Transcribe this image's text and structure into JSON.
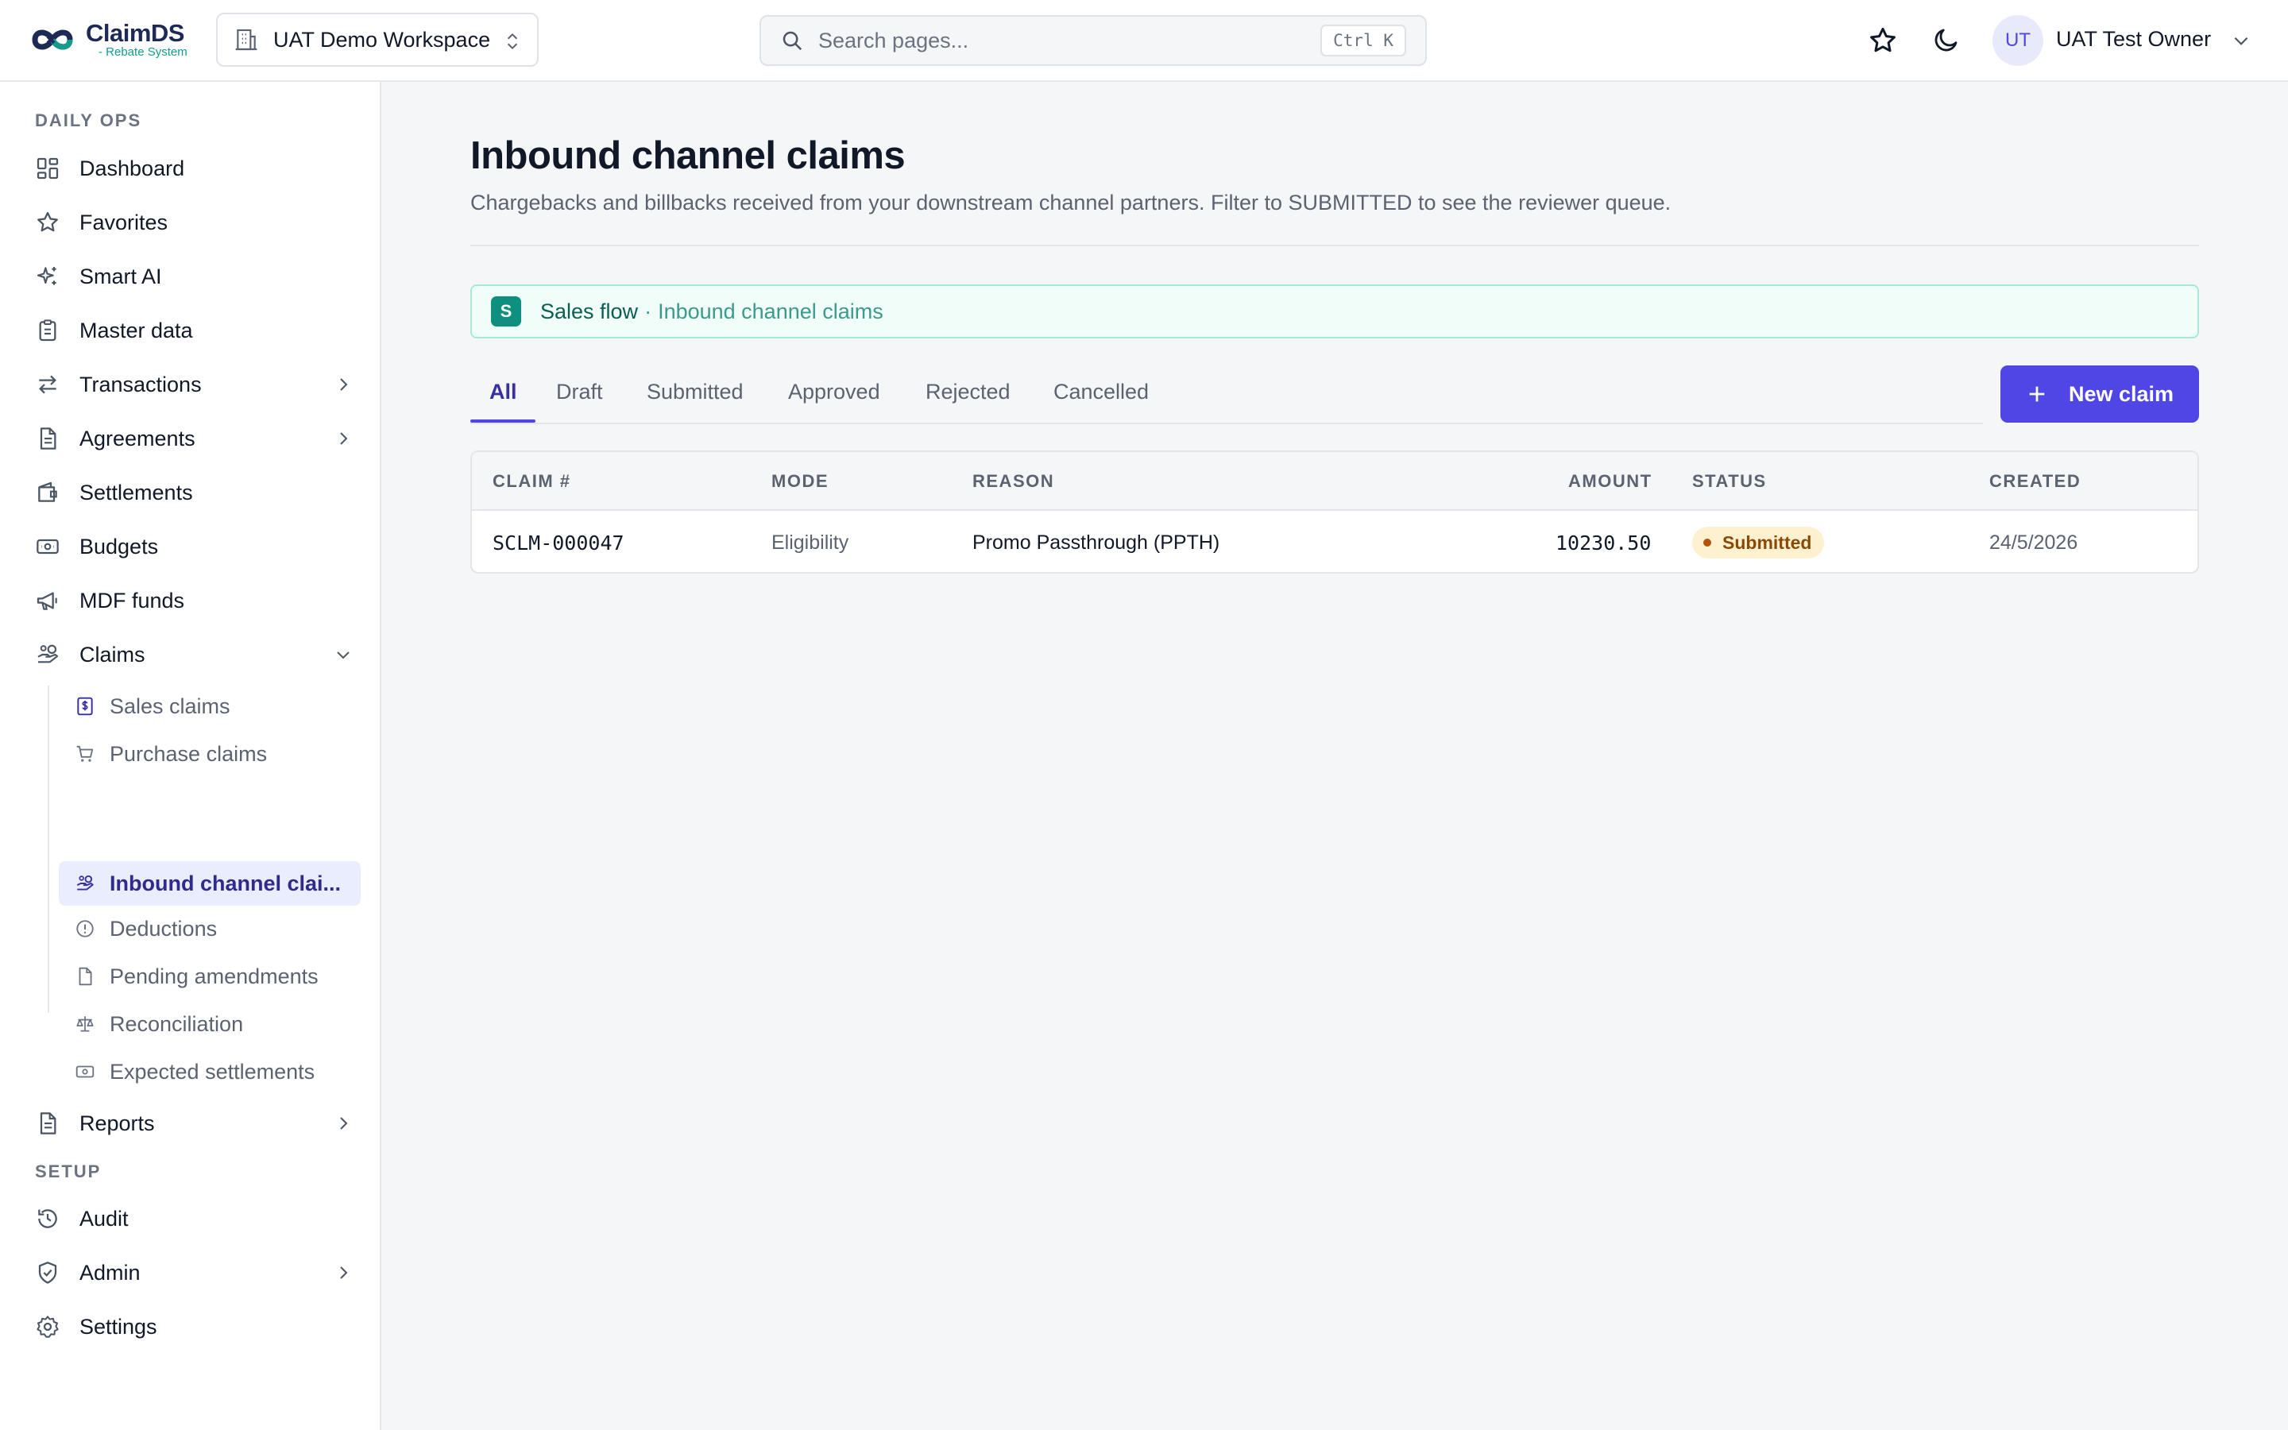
{
  "app": {
    "logo_name": "ClaimDS",
    "logo_tagline": "- Rebate System"
  },
  "header": {
    "workspace": "UAT Demo Workspace",
    "search_placeholder": "Search pages...",
    "search_shortcut": "Ctrl K",
    "user_initials": "UT",
    "user_name": "UAT Test Owner"
  },
  "sidebar": {
    "sections": [
      {
        "label": "DAILY OPS"
      },
      {
        "label": "SETUP"
      }
    ],
    "items": [
      {
        "label": "Dashboard",
        "icon": "dashboard-icon"
      },
      {
        "label": "Favorites",
        "icon": "star-icon"
      },
      {
        "label": "Smart AI",
        "icon": "sparkles-icon"
      },
      {
        "label": "Master data",
        "icon": "clipboard-icon"
      },
      {
        "label": "Transactions",
        "icon": "arrows-exchange-icon"
      },
      {
        "label": "Agreements",
        "icon": "document-icon"
      },
      {
        "label": "Settlements",
        "icon": "wallet-icon"
      },
      {
        "label": "Budgets",
        "icon": "banknote-icon"
      },
      {
        "label": "MDF funds",
        "icon": "megaphone-icon"
      },
      {
        "label": "Claims",
        "icon": "hand-coins-icon"
      },
      {
        "label": "Reports",
        "icon": "report-icon"
      },
      {
        "label": "Audit",
        "icon": "history-icon"
      },
      {
        "label": "Admin",
        "icon": "shield-icon"
      },
      {
        "label": "Settings",
        "icon": "gear-icon"
      }
    ],
    "claims_sub": [
      {
        "label": "Sales claims",
        "icon": "receipt-dollar-icon"
      },
      {
        "label": "Purchase claims",
        "icon": "cart-icon"
      },
      {
        "label": "Inbound channel clai...",
        "icon": "hand-coins-icon"
      },
      {
        "label": "Deductions",
        "icon": "alert-circle-icon"
      },
      {
        "label": "Pending amendments",
        "icon": "file-icon"
      },
      {
        "label": "Reconciliation",
        "icon": "scale-icon"
      },
      {
        "label": "Expected settlements",
        "icon": "banknote-icon"
      }
    ]
  },
  "main": {
    "title": "Inbound channel claims",
    "subtitle": "Chargebacks and billbacks received from your downstream channel partners. Filter to SUBMITTED to see the reviewer queue.",
    "flow": {
      "badge": "S",
      "name": "Sales flow",
      "separator": "·",
      "crumb": "Inbound channel claims"
    },
    "tabs": [
      "All",
      "Draft",
      "Submitted",
      "Approved",
      "Rejected",
      "Cancelled"
    ],
    "new_button": "New claim",
    "table": {
      "columns": [
        "CLAIM #",
        "MODE",
        "REASON",
        "AMOUNT",
        "STATUS",
        "CREATED"
      ],
      "rows": [
        {
          "claim": "SCLM-000047",
          "mode": "Eligibility",
          "reason": "Promo Passthrough (PPTH)",
          "amount": "10230.50",
          "status": "Submitted",
          "created": "24/5/2026"
        }
      ]
    }
  },
  "colors": {
    "accent": "#4f46e5",
    "flow_green": "#0f8f7e",
    "status_submitted_bg": "#fdf1cf"
  }
}
